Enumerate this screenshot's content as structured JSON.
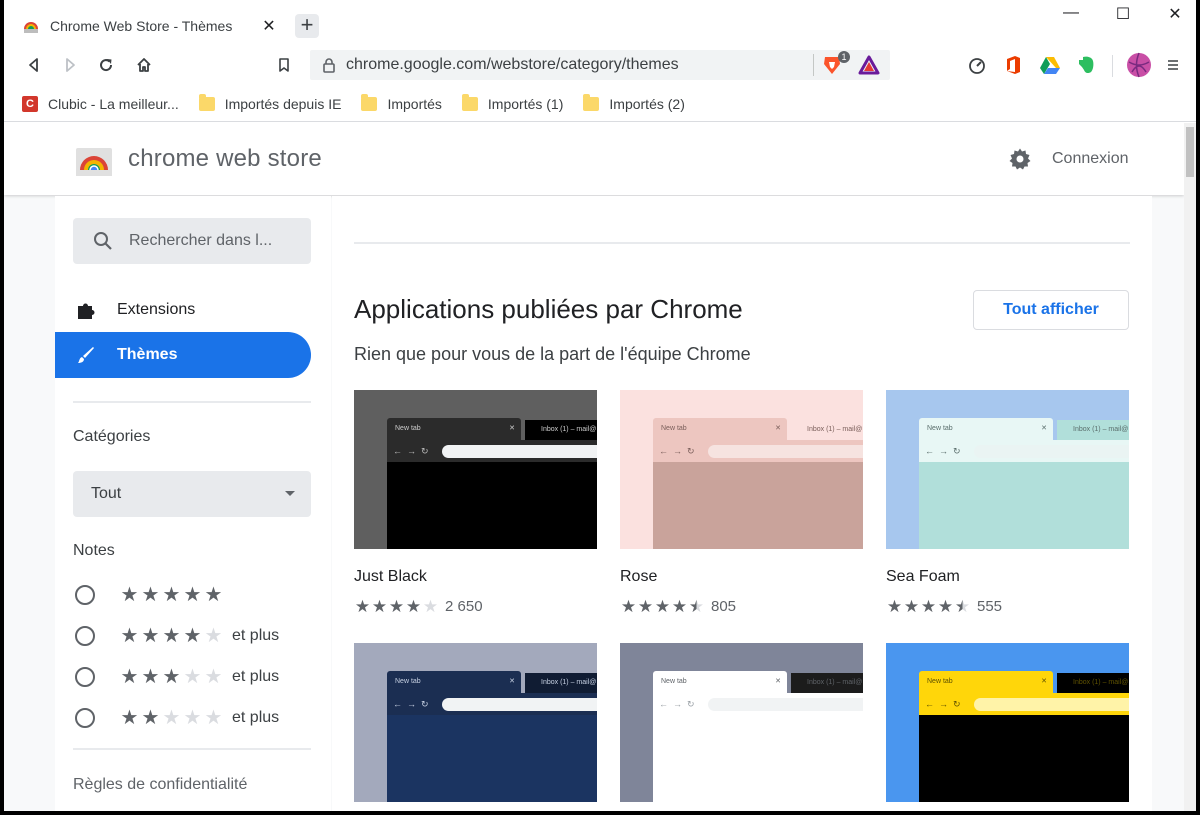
{
  "browser": {
    "tab_title": "Chrome Web Store - Thèmes",
    "tab_close": "✕",
    "new_tab": "+",
    "url": "chrome.google.com/webstore/category/themes",
    "brave_badge": "1",
    "window_controls": {
      "minimize": "—",
      "maximize": "☐",
      "close": "✕"
    }
  },
  "bookmarks": [
    {
      "label": "Clubic - La meilleur...",
      "icon": "clubic-icon",
      "icon_text": "C"
    },
    {
      "label": "Importés depuis IE",
      "icon": "folder-icon"
    },
    {
      "label": "Importés",
      "icon": "folder-icon"
    },
    {
      "label": "Importés (1)",
      "icon": "folder-icon"
    },
    {
      "label": "Importés (2)",
      "icon": "folder-icon"
    }
  ],
  "header": {
    "brand": "chrome web store",
    "signin": "Connexion"
  },
  "sidebar": {
    "search_placeholder": "Rechercher dans l...",
    "nav": [
      {
        "label": "Extensions",
        "icon": "puzzle-icon",
        "active": false
      },
      {
        "label": "Thèmes",
        "icon": "brush-icon",
        "active": true
      }
    ],
    "categories_title": "Catégories",
    "category_selected": "Tout",
    "ratings_title": "Notes",
    "rating_filters": [
      {
        "stars": 5,
        "suffix": ""
      },
      {
        "stars": 4,
        "suffix": "et plus"
      },
      {
        "stars": 3,
        "suffix": "et plus"
      },
      {
        "stars": 2,
        "suffix": "et plus"
      }
    ],
    "privacy": "Règles de confidentialité"
  },
  "main": {
    "title": "Applications publiées par Chrome",
    "subtitle": "Rien que pour vous de la part de l'équipe Chrome",
    "view_all": "Tout afficher",
    "mini_tab_label": "New tab",
    "mini_tab2_label": "Inbox (1) – mail@",
    "themes": [
      {
        "name": "Just Black",
        "rating": 4.0,
        "count": "2 650",
        "bg": "#5f5f5f",
        "tab": "#2b2b2b",
        "tabtext": "#cccccc",
        "tool": "#2b2b2b",
        "bar": "#f1f3f4",
        "body": "#000000",
        "tab2": "#000000",
        "arrows": "#bbbbbb"
      },
      {
        "name": "Rose",
        "rating": 4.5,
        "count": "805",
        "bg": "#fbe1df",
        "tab": "#edc6c0",
        "tabtext": "#7a5e5a",
        "tool": "#edc6c0",
        "bar": "#f6e3e0",
        "body": "#c9a39b",
        "tab2": "#fbe1df",
        "arrows": "#7a5e5a"
      },
      {
        "name": "Sea Foam",
        "rating": 4.5,
        "count": "555",
        "bg": "#a7c7ee",
        "tab": "#e8f7f5",
        "tabtext": "#5a6e6c",
        "tool": "#e8f7f5",
        "bar": "#eaf4f3",
        "body": "#b1dfda",
        "tab2": "#b1dfda",
        "arrows": "#5a6e6c"
      },
      {
        "name": "",
        "rating": 0,
        "count": "",
        "bg": "#a3a9bc",
        "tab": "#1b2e52",
        "tabtext": "#c6d0e2",
        "tool": "#1b2e52",
        "bar": "#f1f3f4",
        "body": "#1b3461",
        "tab2": "#101c33",
        "arrows": "#c6d0e2"
      },
      {
        "name": "",
        "rating": 0,
        "count": "",
        "bg": "#7f8599",
        "tab": "#ffffff",
        "tabtext": "#5f6368",
        "tool": "#ffffff",
        "bar": "#f1f3f4",
        "body": "#ffffff",
        "tab2": "#1c1c1c",
        "arrows": "#9aa0a6"
      },
      {
        "name": "",
        "rating": 0,
        "count": "",
        "bg": "#4a96ef",
        "tab": "#ffd60a",
        "tabtext": "#5f5200",
        "tool": "#ffd60a",
        "bar": "#fff3a8",
        "body": "#000000",
        "tab2": "#000000",
        "arrows": "#5f5200"
      }
    ]
  },
  "colors": {
    "accent": "#1a73e8",
    "star": "#5f6368",
    "star_empty": "#dadce0"
  }
}
